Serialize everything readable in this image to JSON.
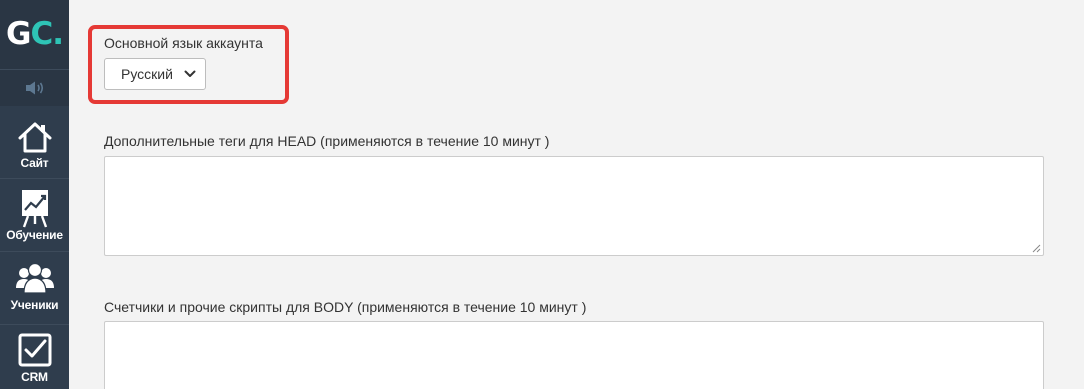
{
  "sidebar": {
    "logo_g": "G",
    "logo_c": "C",
    "logo_dot": ".",
    "items": [
      {
        "label": "Сайт",
        "icon": "house-icon"
      },
      {
        "label": "Обучение",
        "icon": "chart-board-icon"
      },
      {
        "label": "Ученики",
        "icon": "users-icon"
      },
      {
        "label": "CRM",
        "icon": "checkbox-icon"
      }
    ]
  },
  "settings": {
    "account_language": {
      "label": "Основной язык аккаунта",
      "selected": "Русский"
    },
    "head_tags": {
      "label": "Дополнительные теги для HEAD (применяются в течение 10 минут )",
      "value": ""
    },
    "body_scripts": {
      "label": "Счетчики и прочие скрипты для BODY (применяются в течение 10 минут )",
      "value": ""
    }
  },
  "colors": {
    "sidebar_bg": "#2f3d4d",
    "logo_accent": "#2ec4b6",
    "highlight_border": "#e53935",
    "page_bg": "#f3f3f3"
  }
}
